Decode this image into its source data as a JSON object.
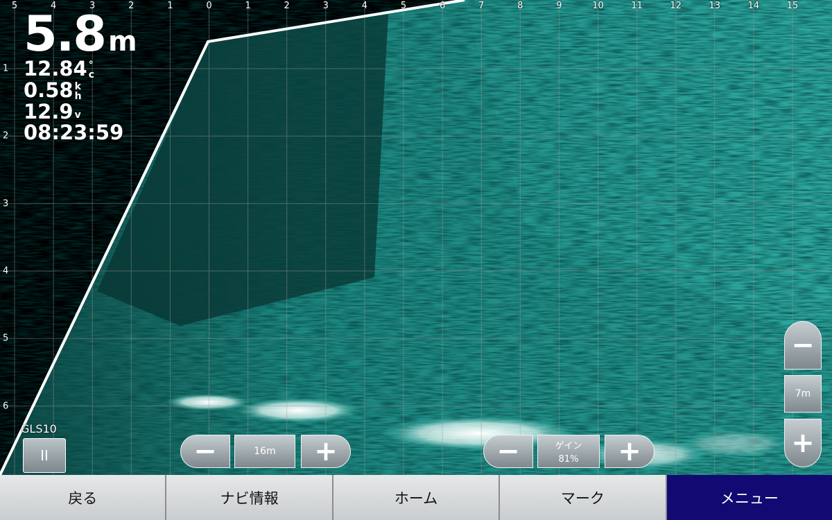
{
  "range_scale": {
    "horizontal": [
      "5",
      "4",
      "3",
      "2",
      "1",
      "0",
      "1",
      "2",
      "3",
      "4",
      "5",
      "6",
      "7",
      "8",
      "9",
      "10",
      "11",
      "12",
      "13",
      "14",
      "15"
    ],
    "vertical": [
      "1",
      "2",
      "3",
      "4",
      "5",
      "6"
    ]
  },
  "readout": {
    "depth_value": "5.8",
    "depth_unit": "m",
    "water_temp_value": "12.84",
    "water_temp_unit_top": "°",
    "water_temp_unit_bottom": "c",
    "speed_value": "0.58",
    "speed_unit_top": "k",
    "speed_unit_bottom": "h",
    "voltage_value": "12.9",
    "voltage_unit": "v",
    "time": "08:23:59"
  },
  "source": {
    "label": "GLS10",
    "pause_label": "II"
  },
  "range_control": {
    "minus_label": "−",
    "value": "16m",
    "plus_label": "+"
  },
  "gain_control": {
    "minus_label": "−",
    "title": "ゲイン",
    "value": "81%",
    "plus_label": "+"
  },
  "zoom_control": {
    "minus_label": "−",
    "value": "7m",
    "plus_label": "+"
  },
  "bottom_bar": {
    "items": [
      {
        "label": "戻る"
      },
      {
        "label": "ナビ情報"
      },
      {
        "label": "ホーム"
      },
      {
        "label": "マーク"
      },
      {
        "label": "メニュー"
      }
    ]
  },
  "colors": {
    "sonar_echo": "#2fb7ad",
    "sonar_strong": "#ffffff",
    "menu_active": "#120a72",
    "grid": "#9a9a9a"
  }
}
